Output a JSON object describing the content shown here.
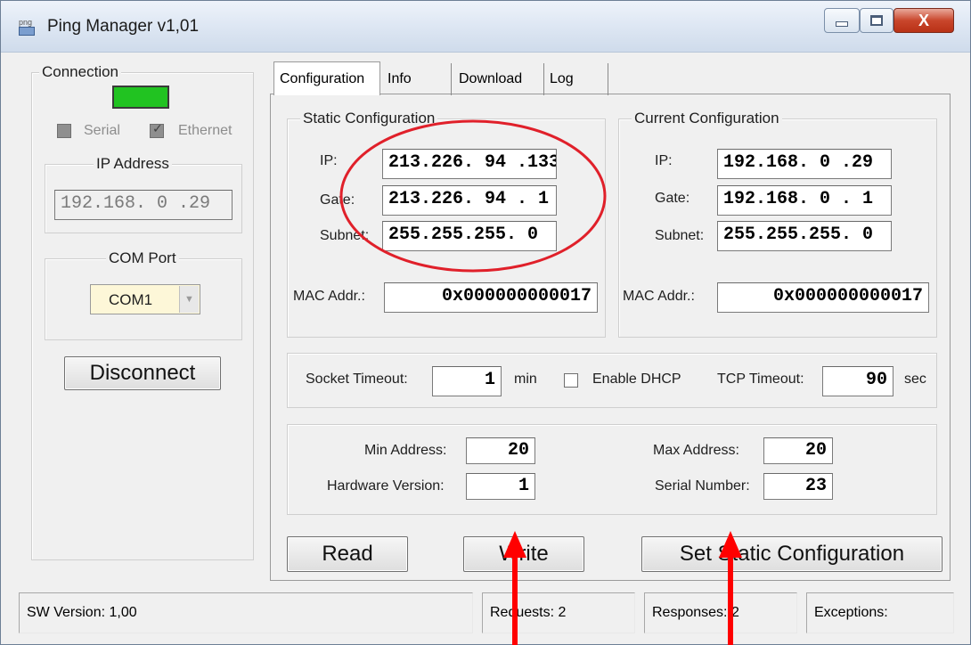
{
  "window": {
    "title": "Ping Manager v1,01",
    "close_glyph": "X",
    "app_icon_text": "png"
  },
  "connection": {
    "legend": "Connection",
    "indicator_color": "#21c321",
    "serial_label": "Serial",
    "ethernet_label": "Ethernet",
    "ip_legend": "IP Address",
    "ip_value": "192.168. 0 .29",
    "com_legend": "COM Port",
    "com_value": "COM1",
    "disconnect_label": "Disconnect"
  },
  "tabs": [
    "Configuration",
    "Info",
    "Download",
    "Log"
  ],
  "static_config": {
    "legend": "Static Configuration",
    "ip_label": "IP:",
    "ip": "213.226. 94 .133",
    "gate_label": "Gate:",
    "gate": "213.226. 94 . 1",
    "subnet_label": "Subnet:",
    "subnet": "255.255.255. 0",
    "mac_label": "MAC Addr.:",
    "mac": "0x000000000017"
  },
  "current_config": {
    "legend": "Current Configuration",
    "ip_label": "IP:",
    "ip": "192.168. 0 .29",
    "gate_label": "Gate:",
    "gate": "192.168. 0 . 1",
    "subnet_label": "Subnet:",
    "subnet": "255.255.255. 0",
    "mac_label": "MAC Addr.:",
    "mac": "0x000000000017"
  },
  "timeouts": {
    "socket_label": "Socket Timeout:",
    "socket_value": "1",
    "socket_unit": "min",
    "dhcp_label": "Enable DHCP",
    "tcp_label": "TCP Timeout:",
    "tcp_value": "90",
    "tcp_unit": "sec"
  },
  "device": {
    "min_address_label": "Min Address:",
    "min_address": "20",
    "max_address_label": "Max Address:",
    "max_address": "20",
    "hw_version_label": "Hardware Version:",
    "hw_version": "1",
    "serial_number_label": "Serial Number:",
    "serial_number": "23"
  },
  "buttons": {
    "read": "Read",
    "write": "Write",
    "set_static": "Set Static Configuration"
  },
  "status_bar": {
    "sw_version": "SW Version: 1,00",
    "requests": "Requests: 2",
    "responses": "Responses: 2",
    "exceptions": "Exceptions:"
  },
  "annotation_color": "#ff0000"
}
